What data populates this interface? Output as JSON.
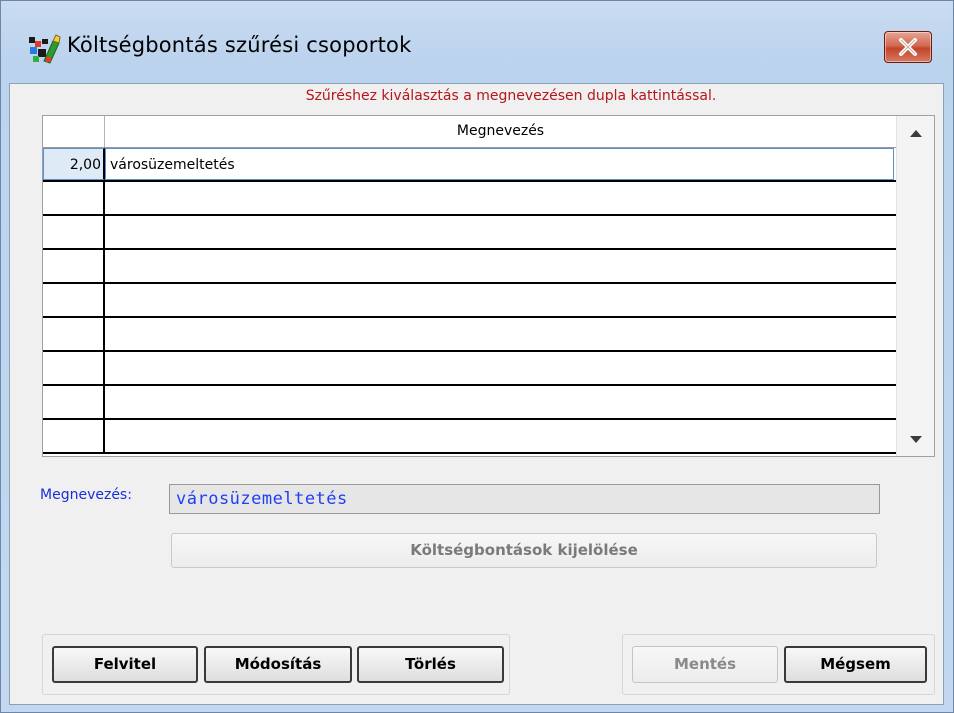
{
  "window": {
    "title": "Költségbontás szűrési csoportok",
    "close_symbol": "✕"
  },
  "hint": "Szűréshez kiválasztás a megnevezésen dupla kattintással.",
  "grid": {
    "column_header": "Megnevezés",
    "rows": [
      {
        "num": "2,00",
        "name": "városüzemeltetés"
      },
      {
        "num": "",
        "name": ""
      },
      {
        "num": "",
        "name": ""
      },
      {
        "num": "",
        "name": ""
      },
      {
        "num": "",
        "name": ""
      },
      {
        "num": "",
        "name": ""
      },
      {
        "num": "",
        "name": ""
      },
      {
        "num": "",
        "name": ""
      },
      {
        "num": "",
        "name": ""
      }
    ]
  },
  "field": {
    "label": "Megnevezés:",
    "value": "városüzemeltetés"
  },
  "buttons": {
    "select_breakdowns": "Költségbontások kijelölése",
    "add": "Felvitel",
    "modify": "Módosítás",
    "delete": "Törlés",
    "save": "Mentés",
    "cancel": "Mégsem"
  },
  "colors": {
    "hint": "#b5161b",
    "field_label": "#1a2ed8",
    "field_value": "#1f3ff3",
    "close_button": "#c2452b"
  },
  "icons": {
    "app": "app-icon",
    "close": "close-icon",
    "scroll_up": "scroll-up-icon",
    "scroll_down": "scroll-down-icon"
  }
}
